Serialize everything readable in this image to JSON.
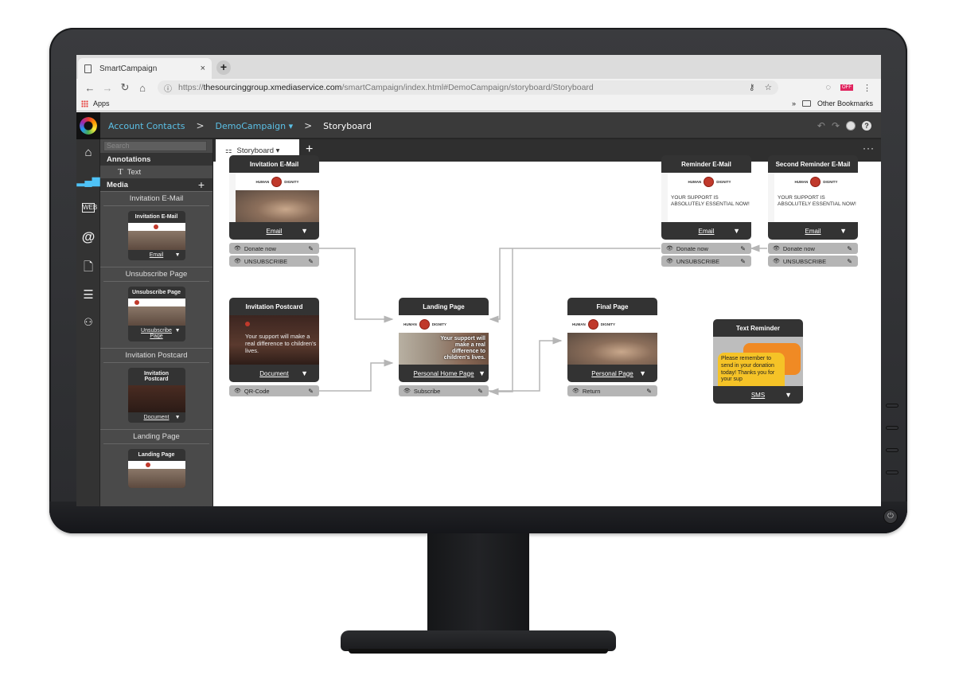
{
  "browser": {
    "tab_title": "SmartCampaign",
    "tab_close": "×",
    "new_tab": "+",
    "url_host_prefix": "https://",
    "url_host": "thesourcinggroup.xmediaservice.com",
    "url_path": "/smartCampaign/index.html#DemoCampaign/storyboard/Storyboard",
    "extension_badge": "OFF",
    "bookmarks": {
      "apps": "Apps",
      "overflow": "»",
      "other": "Other Bookmarks"
    }
  },
  "app": {
    "breadcrumbs": [
      {
        "label": "Account Contacts"
      },
      {
        "label": "DemoCampaign ▾"
      },
      {
        "label": "Storyboard"
      }
    ],
    "breadcrumb_separator": ">",
    "left_nav": [
      "home-icon",
      "analytics-icon",
      "web-icon",
      "email-icon",
      "document-icon",
      "database-icon",
      "workflow-icon"
    ],
    "panel": {
      "search_placeholder": "Search",
      "annotations_label": "Annotations",
      "annotations_items": [
        {
          "icon": "T",
          "label": "Text"
        }
      ],
      "media_label": "Media",
      "media_add": "+",
      "media_groups": [
        {
          "title": "Invitation E-Mail",
          "thumb_title": "Invitation E-Mail",
          "type": "Email"
        },
        {
          "title": "Unsubscribe Page",
          "thumb_title": "Unsubscribe Page",
          "type": "Unsubscribe Page"
        },
        {
          "title": "Invitation Postcard",
          "thumb_title": "Invitation Postcard",
          "type": "Document"
        },
        {
          "title": "Landing Page",
          "thumb_title": "Landing Page",
          "type": ""
        }
      ]
    },
    "workspace": {
      "tab_label": "Storyboard ▾",
      "add_tab": "+",
      "more": "···"
    },
    "brand": {
      "left": "HUMAN",
      "right": "DIGNITY"
    },
    "nodes": {
      "invitation_email": {
        "title": "Invitation E-Mail",
        "type": "Email",
        "actions": [
          "Donate now",
          "UNSUBSCRIBE"
        ]
      },
      "reminder_email": {
        "title": "Reminder E-Mail",
        "type": "Email",
        "body": "YOUR SUPPORT IS ABSOLUTELY ESSENTIAL NOW!",
        "actions": [
          "Donate now",
          "UNSUBSCRIBE"
        ]
      },
      "second_reminder_email": {
        "title": "Second Reminder E-Mail",
        "type": "Email",
        "body": "YOUR SUPPORT IS ABSOLUTELY ESSENTIAL NOW!",
        "actions": [
          "Donate now",
          "UNSUBSCRIBE"
        ]
      },
      "invitation_postcard": {
        "title": "Invitation Postcard",
        "type": "Document",
        "body": "Your support will make a real difference to children's lives.",
        "actions": [
          "QR-Code"
        ]
      },
      "landing_page": {
        "title": "Landing Page",
        "type": "Personal Home Page",
        "body": "Your support will make a real difference to children's lives.",
        "actions": [
          "Subscribe"
        ]
      },
      "final_page": {
        "title": "Final Page",
        "type": "Personal Page",
        "actions": [
          "Return"
        ]
      },
      "text_reminder": {
        "title": "Text Reminder",
        "type": "SMS",
        "body": "Please remember to send in your donation today!  Thanks you for your sup"
      }
    }
  },
  "colors": {
    "accent": "#5bc0e6",
    "app_dark": "#333333",
    "action_gray": "#b5b5b5",
    "brand_red": "#c0392b",
    "sms_yellow": "#f5c327",
    "sms_orange": "#f08a24"
  }
}
